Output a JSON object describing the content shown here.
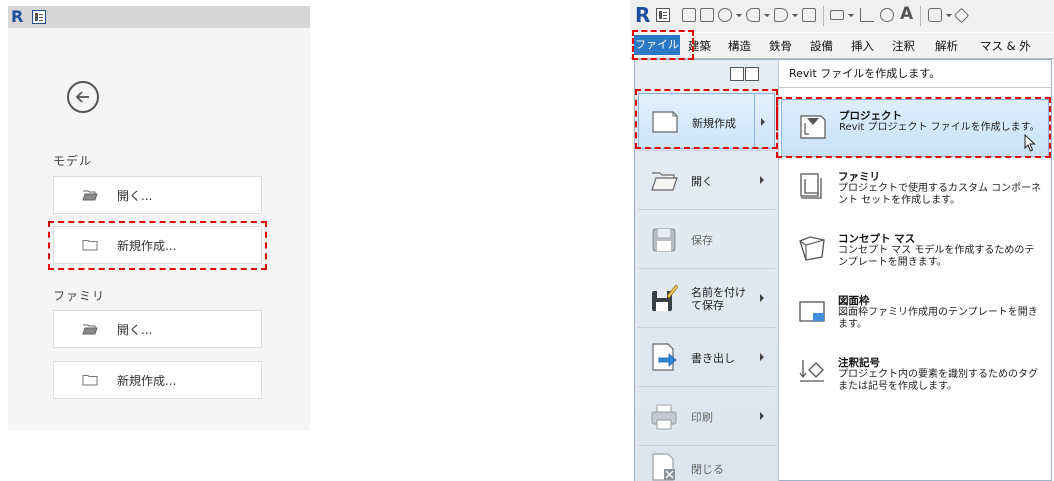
{
  "left_panel": {
    "logo": "R",
    "sections": [
      {
        "label": "モデル",
        "buttons": [
          {
            "label": "開く...",
            "icon": "folder-open-icon"
          },
          {
            "label": "新規作成...",
            "icon": "new-folder-icon",
            "highlighted": true
          }
        ]
      },
      {
        "label": "ファミリ",
        "buttons": [
          {
            "label": "開く...",
            "icon": "folder-open-icon"
          },
          {
            "label": "新規作成...",
            "icon": "new-folder-icon"
          }
        ]
      }
    ]
  },
  "right_panel": {
    "logo": "R",
    "ribbon_tabs": [
      "ファイル",
      "建築",
      "構造",
      "鉄骨",
      "設備",
      "挿入",
      "注釈",
      "解析",
      "マス & 外"
    ],
    "highlight_color": "#e00000",
    "file_tab_color": "#2b78c4",
    "menu_items": [
      {
        "label": "新規作成",
        "icon": "new-document-icon",
        "has_submenu": true,
        "active": true
      },
      {
        "label": "開く",
        "icon": "open-folder-icon",
        "has_submenu": true
      },
      {
        "label": "保存",
        "icon": "save-disk-icon",
        "has_submenu": false,
        "disabled": true
      },
      {
        "label_line1": "名前を付け",
        "label_line2": "て保存",
        "icon": "save-as-icon",
        "has_submenu": true
      },
      {
        "label": "書き出し",
        "icon": "export-icon",
        "has_submenu": true
      },
      {
        "label": "印刷",
        "icon": "print-icon",
        "has_submenu": true,
        "disabled": true
      },
      {
        "label": "閉じる",
        "icon": "close-document-icon",
        "has_submenu": false,
        "disabled": true
      }
    ],
    "submenu": {
      "header": "Revit ファイルを作成します。",
      "items": [
        {
          "title": "プロジェクト",
          "desc": "Revit プロジェクト ファイルを作成します。",
          "icon": "project-icon",
          "active": true
        },
        {
          "title": "ファミリ",
          "desc": "プロジェクトで使用するカスタム コンポーネント セットを作成します。",
          "icon": "family-icon"
        },
        {
          "title": "コンセプト マス",
          "desc": "コンセプト マス モデルを作成するためのテンプレートを開きます。",
          "icon": "conceptual-mass-icon"
        },
        {
          "title": "図面枠",
          "desc": "図面枠ファミリ作成用のテンプレートを開きます。",
          "icon": "title-block-icon"
        },
        {
          "title": "注釈記号",
          "desc": "プロジェクト内の要素を識別するためのタグまたは記号を作成します。",
          "icon": "annotation-symbol-icon"
        }
      ]
    }
  }
}
